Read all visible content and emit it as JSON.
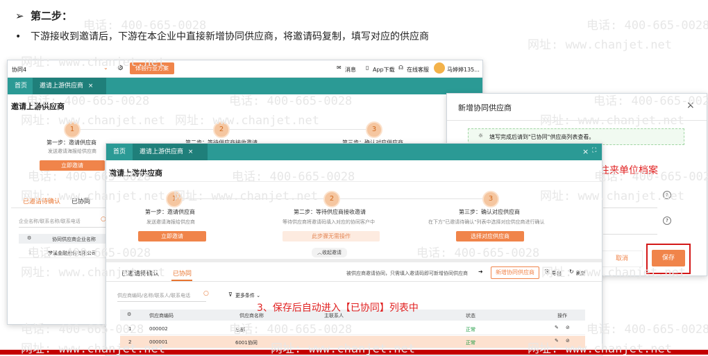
{
  "slide": {
    "title_marker": "➢",
    "title": "第二步：",
    "bullet_marker": "•",
    "bullet": "下游接收到邀请后，下游在本企业中直接新增协同供应商，将邀请码复制，填写对应的供应商"
  },
  "watermark": {
    "phone": "电话: 400-665-0028",
    "site": "网址: www.chanjet.net"
  },
  "back_window": {
    "company": "协同4",
    "experience_btn": "体验行业方案",
    "message": "消息",
    "app_download": "App下载",
    "online_service": "在线客服",
    "user": "马婷婷135...",
    "tab_home": "首页",
    "tab_invite": "邀请上游供应商",
    "page_title": "邀请上游供应商",
    "steps": [
      {
        "num": "1",
        "label": "第一步：邀请供应商",
        "sub": "发送邀请海报给供应商",
        "btn": "立即邀请"
      },
      {
        "num": "2",
        "label": "第二步：等待供应商接收邀请"
      },
      {
        "num": "3",
        "label": "第三步：确认对应供应商"
      }
    ],
    "subtab_pending": "已邀请待确认",
    "subtab_done": "已协同",
    "search_placeholder": "企业名称/联系名称/联系电话",
    "col_supplier": "协同供应商企业名称",
    "row_num": "1",
    "row_name": "梦溪金融股份有限公司"
  },
  "dialog": {
    "title": "新增协同供应商",
    "hint": "填写完成后请到\"已协同\"供应商列表查看。",
    "overlay_text": "往来单位档案",
    "cancel": "取消",
    "save": "保存"
  },
  "front_window": {
    "tab_home": "首页",
    "tab_invite": "邀请上游供应商",
    "page_title": "邀请上游供应商",
    "steps": [
      {
        "num": "1",
        "label": "第一步：邀请供应商",
        "sub": "发送邀请海报给供应商",
        "btn": "立即邀请"
      },
      {
        "num": "2",
        "label": "第二步：等待供应商接收邀请",
        "sub": "等待供应商将邀请码填入对应的协同客户中",
        "btn": "此步骤无需操作"
      },
      {
        "num": "3",
        "label": "第三步：确认对应供应商",
        "sub": "在下方\"已邀请待确认\"列表中选择对应供应商进行确认",
        "btn": "选择对应供应商"
      }
    ],
    "collapse": "收起邀请",
    "subtab_pending": "已邀请待确认",
    "subtab_done": "已协同",
    "notice": "被供应商邀请协同，只需填入邀请码即可新增协同供应商",
    "add_btn": "新增协同供应商",
    "export": "导出",
    "refresh": "刷新",
    "search_placeholder": "供应商编码/名称/联系人/联系电话",
    "more_filters": "更多条件",
    "columns": [
      "供应商编码",
      "供应商名称",
      "主联系人",
      "状态",
      "操作"
    ],
    "rows": [
      {
        "no": "1",
        "code": "000002",
        "name": "总部",
        "status": "正常"
      },
      {
        "no": "2",
        "code": "000001",
        "name": "6001协同",
        "status": "正常"
      }
    ]
  },
  "annotation": "3、保存后自动进入【已协同】列表中"
}
